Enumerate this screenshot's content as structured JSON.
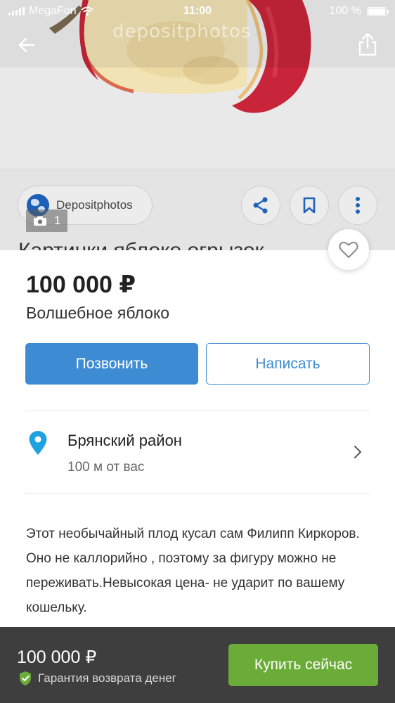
{
  "status_bar": {
    "carrier": "MegaFon",
    "time": "11:00",
    "battery": "100 %"
  },
  "photo": {
    "watermark": "depositphotos",
    "source_name": "Depositphotos",
    "photo_count": "1",
    "peek_title": "Картинки яблоко огрызок"
  },
  "listing": {
    "price": "100 000 ₽",
    "title": "Волшебное яблоко",
    "call_label": "Позвонить",
    "write_label": "Написать",
    "location_name": "Брянский район",
    "location_distance": "100  м от вас",
    "description": "Этот необычайный плод кусал сам Филипп Киркоров. Оно не каллорийно , поэтому за фигуру можно не переживать.Невысокая цена- не ударит по вашему кошельку."
  },
  "bottom_bar": {
    "price": "100 000 ₽",
    "guarantee": "Гарантия возврата денег",
    "buy_label": "Купить сейчас"
  },
  "colors": {
    "primary": "#3d8cd3",
    "buy": "#6aac37",
    "bottom_bar": "#3e3e3e",
    "apple_red": "#c8243a"
  },
  "icons": [
    "back-arrow-icon",
    "share-icon",
    "globe-icon",
    "share-nodes-icon",
    "bookmark-icon",
    "more-vertical-icon",
    "camera-icon",
    "heart-icon",
    "location-pin-icon",
    "chevron-right-icon",
    "shield-check-icon",
    "wifi-icon",
    "signal-icon",
    "battery-icon"
  ]
}
